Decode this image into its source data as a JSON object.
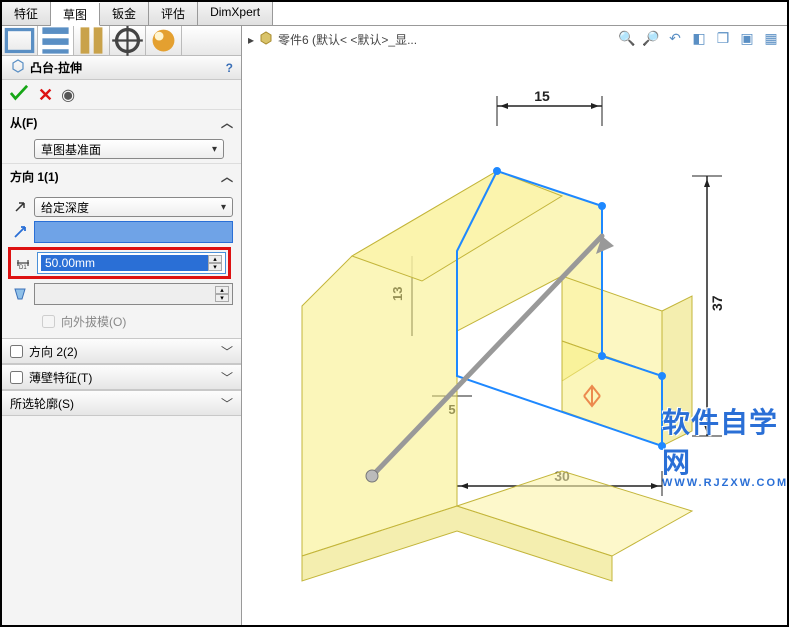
{
  "tabs": [
    "特征",
    "草图",
    "钣金",
    "评估",
    "DimXpert"
  ],
  "active_tab_index": 1,
  "feature": {
    "title": "凸台-拉伸",
    "help": "?"
  },
  "groups": {
    "from": {
      "label": "从(F)",
      "dropdown": "草图基准面"
    },
    "dir1": {
      "label": "方向 1(1)",
      "end_condition": "给定深度",
      "depth_label": "D1",
      "depth_value": "50.00mm",
      "draft_label": "向外拔模(O)"
    },
    "dir2": {
      "label": "方向 2(2)"
    },
    "thin": {
      "label": "薄壁特征(T)"
    },
    "contours": {
      "label": "所选轮廓(S)"
    }
  },
  "breadcrumb": "零件6  (默认< <默认>_显...",
  "dimensions": {
    "top": "15",
    "left": "13",
    "bottom_small": "5",
    "bottom": "30",
    "right": "37"
  },
  "watermark": {
    "text": "软件自学网",
    "sub": "WWW.RJZXW.COM"
  }
}
